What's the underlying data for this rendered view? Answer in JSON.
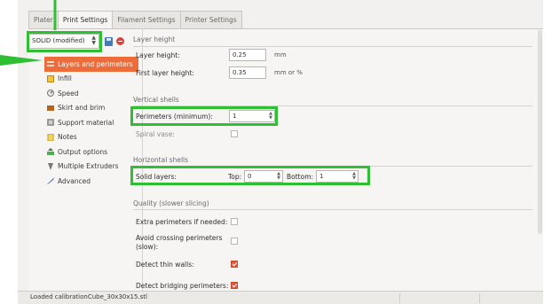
{
  "tabs": [
    "Plater",
    "Print Settings",
    "Filament Settings",
    "Printer Settings"
  ],
  "active_tab": 1,
  "preset": {
    "value": "SOLID (modified)"
  },
  "nav": {
    "items": [
      {
        "label": "Layers and perimeters",
        "icon": "layers-icon"
      },
      {
        "label": "Infill",
        "icon": "infill-icon"
      },
      {
        "label": "Speed",
        "icon": "speed-icon"
      },
      {
        "label": "Skirt and brim",
        "icon": "skirt-icon"
      },
      {
        "label": "Support material",
        "icon": "support-icon"
      },
      {
        "label": "Notes",
        "icon": "notes-icon"
      },
      {
        "label": "Output options",
        "icon": "output-icon"
      },
      {
        "label": "Multiple Extruders",
        "icon": "extruders-icon"
      },
      {
        "label": "Advanced",
        "icon": "advanced-icon"
      }
    ],
    "active": 0
  },
  "layer_height": {
    "title": "Layer height",
    "layer_height_label": "Layer height:",
    "layer_height_value": "0.25",
    "layer_height_unit": "mm",
    "first_layer_label": "First layer height:",
    "first_layer_value": "0.35",
    "first_layer_unit": "mm or %"
  },
  "vertical_shells": {
    "title": "Vertical shells",
    "perimeters_label": "Perimeters (minimum):",
    "perimeters_value": "1",
    "spiral_vase_label": "Spiral vase:",
    "spiral_vase_checked": false
  },
  "horizontal_shells": {
    "title": "Horizontal shells",
    "solid_layers_label": "Solid layers:",
    "top_label": "Top:",
    "top_value": "0",
    "bottom_label": "Bottom:",
    "bottom_value": "1"
  },
  "quality": {
    "title": "Quality (slower slicing)",
    "extra_perimeters_label": "Extra perimeters if needed:",
    "extra_perimeters_checked": false,
    "avoid_crossing_label_1": "Avoid crossing perimeters",
    "avoid_crossing_label_2": "(slow):",
    "avoid_crossing_checked": false,
    "detect_thin_walls_label": "Detect thin walls:",
    "detect_thin_walls_checked": true,
    "detect_bridging_label": "Detect bridging perimeters:",
    "detect_bridging_checked": true
  },
  "status": {
    "message": "Loaded calibrationCube_30x30x15.stl"
  },
  "colors": {
    "highlight": "#2fbf33",
    "nav_active": "#ec6c3a",
    "checkbox_checked": "#e05a3a"
  }
}
